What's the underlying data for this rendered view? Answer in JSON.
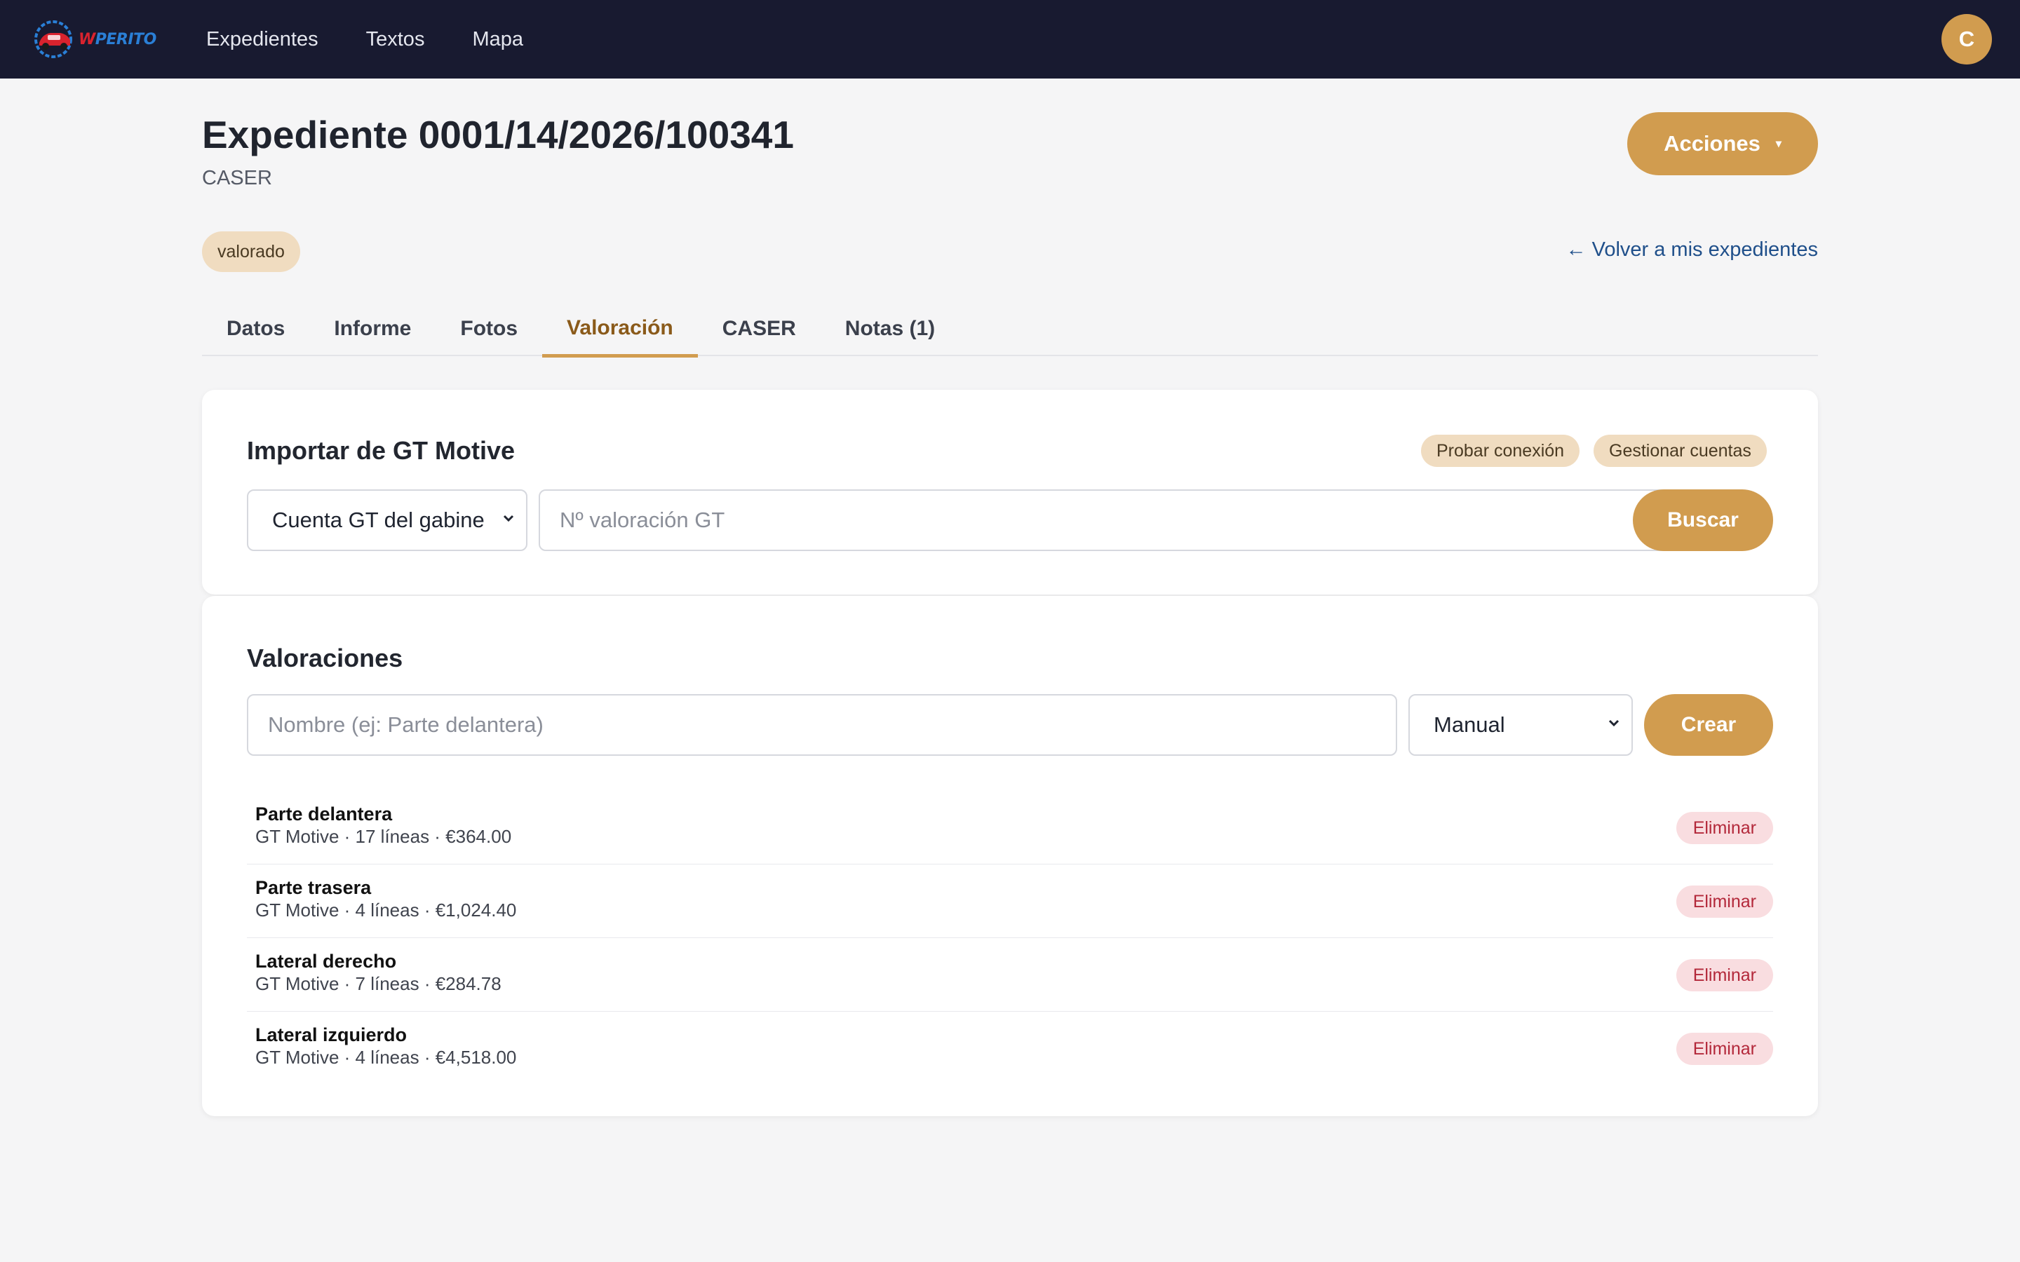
{
  "app": {
    "logo_text_w": "W",
    "logo_text_rest": "PERITO"
  },
  "nav": {
    "items": [
      {
        "label": "Expedientes"
      },
      {
        "label": "Textos"
      },
      {
        "label": "Mapa"
      }
    ],
    "avatar_initial": "C"
  },
  "header": {
    "title": "Expediente 0001/14/2026/100341",
    "subtitle": "CASER",
    "actions_label": "Acciones",
    "actions_caret": "▾",
    "status": "valorado",
    "back_link": "← Volver a mis expedientes"
  },
  "tabs": [
    {
      "label": "Datos",
      "active": false
    },
    {
      "label": "Informe",
      "active": false
    },
    {
      "label": "Fotos",
      "active": false
    },
    {
      "label": "Valoración",
      "active": true
    },
    {
      "label": "CASER",
      "active": false
    },
    {
      "label": "Notas (1)",
      "active": false
    }
  ],
  "import_card": {
    "title": "Importar de GT Motive",
    "test_connection": "Probar conexión",
    "manage_accounts": "Gestionar cuentas",
    "account_select_value": "Cuenta GT del gabine",
    "valuation_placeholder": "Nº valoración GT",
    "search_button": "Buscar"
  },
  "valuations_card": {
    "title": "Valoraciones",
    "name_placeholder": "Nombre (ej: Parte delantera)",
    "type_select_value": "Manual",
    "create_button": "Crear",
    "delete_label": "Eliminar",
    "items": [
      {
        "name": "Parte delantera",
        "meta": "GT Motive · 17 líneas · €364.00"
      },
      {
        "name": "Parte trasera",
        "meta": "GT Motive · 4 líneas · €1,024.40"
      },
      {
        "name": "Lateral derecho",
        "meta": "GT Motive · 7 líneas · €284.78"
      },
      {
        "name": "Lateral izquierdo",
        "meta": "GT Motive · 4 líneas · €4,518.00"
      }
    ]
  },
  "colors": {
    "topbar": "#181a30",
    "accent": "#d19c4f",
    "chip_bg": "#f0dcc0",
    "danger_bg": "#f9dde0",
    "danger_text": "#b3283a",
    "link": "#1f4f8a"
  }
}
